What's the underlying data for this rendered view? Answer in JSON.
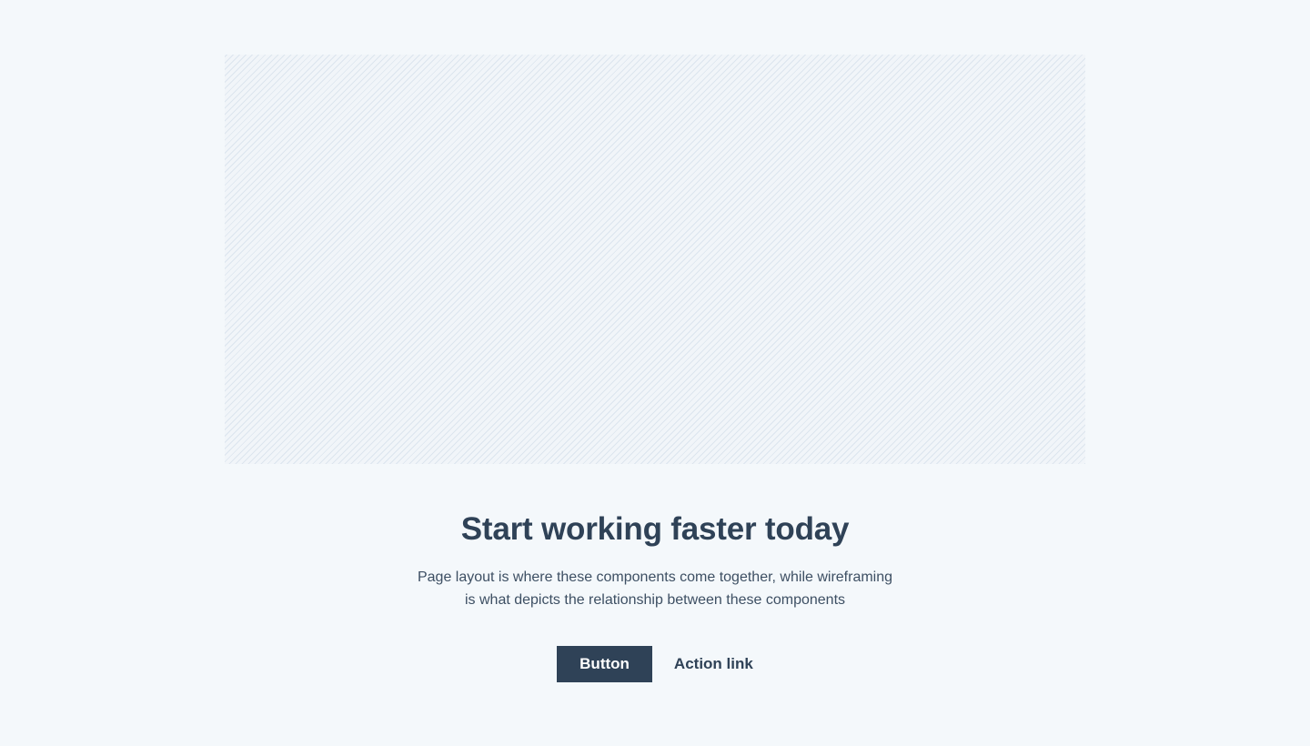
{
  "hero": {
    "image_description": "placeholder image area"
  },
  "content": {
    "title": "Start working faster today",
    "description_line_1": "Page layout is where these components come together, while wireframing",
    "description_line_2": "is what depicts the relationship between these components"
  },
  "actions": {
    "button_label": "Button",
    "link_label": "Action link"
  },
  "colors": {
    "background": "#f4f8fb",
    "primary": "#2f4257",
    "placeholder_stripe": "#dce5ee"
  }
}
